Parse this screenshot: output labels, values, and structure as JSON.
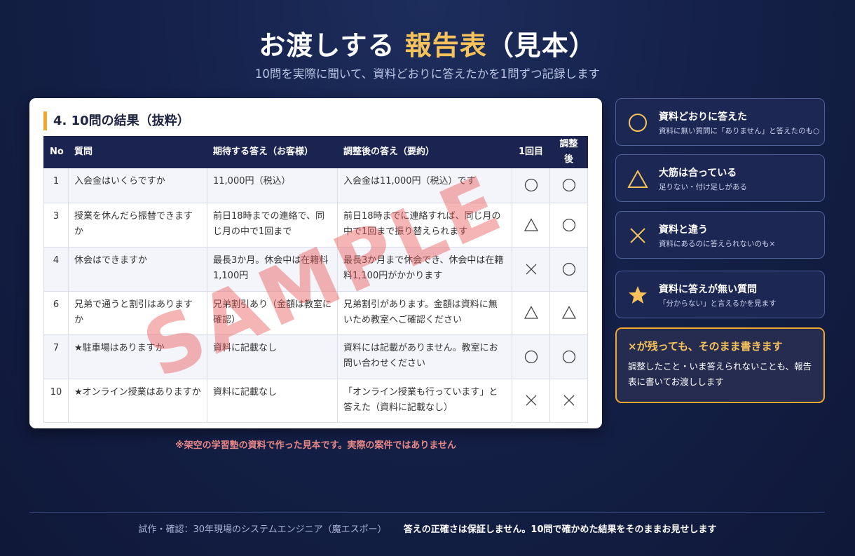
{
  "header": {
    "title_pre": "お渡しする",
    "title_accent": "報告表",
    "title_post": "（見本）",
    "subtitle": "10問を実際に聞いて、資料どおりに答えたかを1問ずつ記録します"
  },
  "report": {
    "section_title": "4. 10問の結果（抜粋）",
    "columns": [
      "No",
      "質問",
      "期待する答え（お客様）",
      "調整後の答え（要約）",
      "1回目",
      "調整後"
    ],
    "rows": [
      {
        "no": "1",
        "question": "入会金はいくらですか",
        "expected": "11,000円（税込）",
        "answer": "入会金は11,000円（税込）です",
        "first": "circle",
        "after": "circle"
      },
      {
        "no": "3",
        "question": "授業を休んだら振替できますか",
        "expected": "前日18時までの連絡で、同じ月の中で1回まで",
        "answer": "前日18時までに連絡すれば、同じ月の中で1回まで振り替えられます",
        "first": "triangle",
        "after": "circle"
      },
      {
        "no": "4",
        "question": "休会はできますか",
        "expected": "最長3か月。休会中は在籍料1,100円",
        "answer": "最長3か月まで休会でき、休会中は在籍料1,100円がかかります",
        "first": "cross",
        "after": "circle"
      },
      {
        "no": "6",
        "question": "兄弟で通うと割引はありますか",
        "expected": "兄弟割引あり（金額は教室に確認）",
        "answer": "兄弟割引があります。金額は資料に無いため教室へご確認ください",
        "first": "triangle",
        "after": "triangle"
      },
      {
        "no": "7",
        "question": "★駐車場はありますか",
        "expected": "資料に記載なし",
        "answer": "資料には記載がありません。教室にお問い合わせください",
        "first": "circle",
        "after": "circle"
      },
      {
        "no": "10",
        "question": "★オンライン授業はありますか",
        "expected": "資料に記載なし",
        "answer": "「オンライン授業も行っています」と答えた（資料に記載なし）",
        "first": "cross",
        "after": "cross"
      }
    ],
    "watermark": "SAMPLE",
    "footnote": "※架空の学習塾の資料で作った見本です。実際の案件ではありません"
  },
  "legend": [
    {
      "icon": "circle",
      "title": "資料どおりに答えた",
      "sub": "資料に無い質問に「ありません」と答えたのも○"
    },
    {
      "icon": "triangle",
      "title": "大筋は合っている",
      "sub": "足りない・付け足しがある"
    },
    {
      "icon": "cross",
      "title": "資料と違う",
      "sub": "資料にあるのに答えられないのも×"
    },
    {
      "icon": "star",
      "title": "資料に答えが無い質問",
      "sub": "「分からない」と言えるかを見ます"
    }
  ],
  "note": {
    "title": "×が残っても、そのまま書きます",
    "body": "調整したこと・いま答えられないことも、報告表に書いてお渡しします"
  },
  "footer": {
    "credit": "試作・確認：30年現場のシステムエンジニア（魔エスポー）",
    "disclaimer": "答えの正確さは保証しません。10問で確かめた結果をそのままお見せします"
  },
  "colors": {
    "accent": "#f6c25a",
    "navy": "#1b2450",
    "orange": "#f0a92e",
    "watermark": "#e85a5a"
  }
}
